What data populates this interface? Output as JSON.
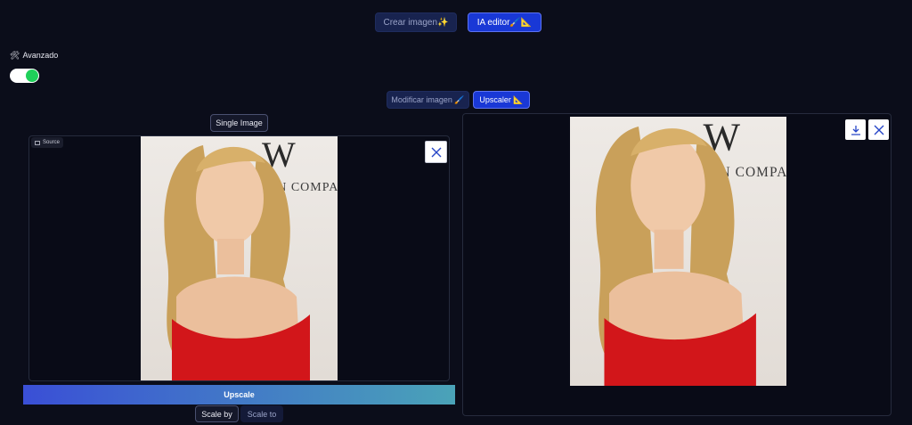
{
  "mode_tabs": {
    "crear": "Crear imagen✨",
    "editor": "IA editor🖌️📐"
  },
  "advanced": {
    "icon": "🛠",
    "label": "Avanzado",
    "toggle_on": true
  },
  "sub_tabs": {
    "modificar": "Modificar imagen 🖌️",
    "upscaler": "Upscaler 📐"
  },
  "input_panel": {
    "single_image_label": "Single Image",
    "source_label": "Source",
    "source_icon": "image-icon",
    "close_icon": "close-icon"
  },
  "photo": {
    "backdrop_text": "EIN COMPA",
    "logo_letter": "W"
  },
  "upscale_button": "Upscale",
  "scale_tabs": {
    "scale_by": "Scale by",
    "scale_to": "Scale to"
  },
  "output_panel": {
    "download_icon": "download-icon",
    "close_icon": "close-icon"
  },
  "colors": {
    "background": "#0b0d1a",
    "accent": "#1938d6",
    "upscale_gradient_start": "#3a4fd6",
    "upscale_gradient_end": "#4aa3b8",
    "toggle_on": "#1fd05a",
    "dress_red": "#d2161a"
  }
}
